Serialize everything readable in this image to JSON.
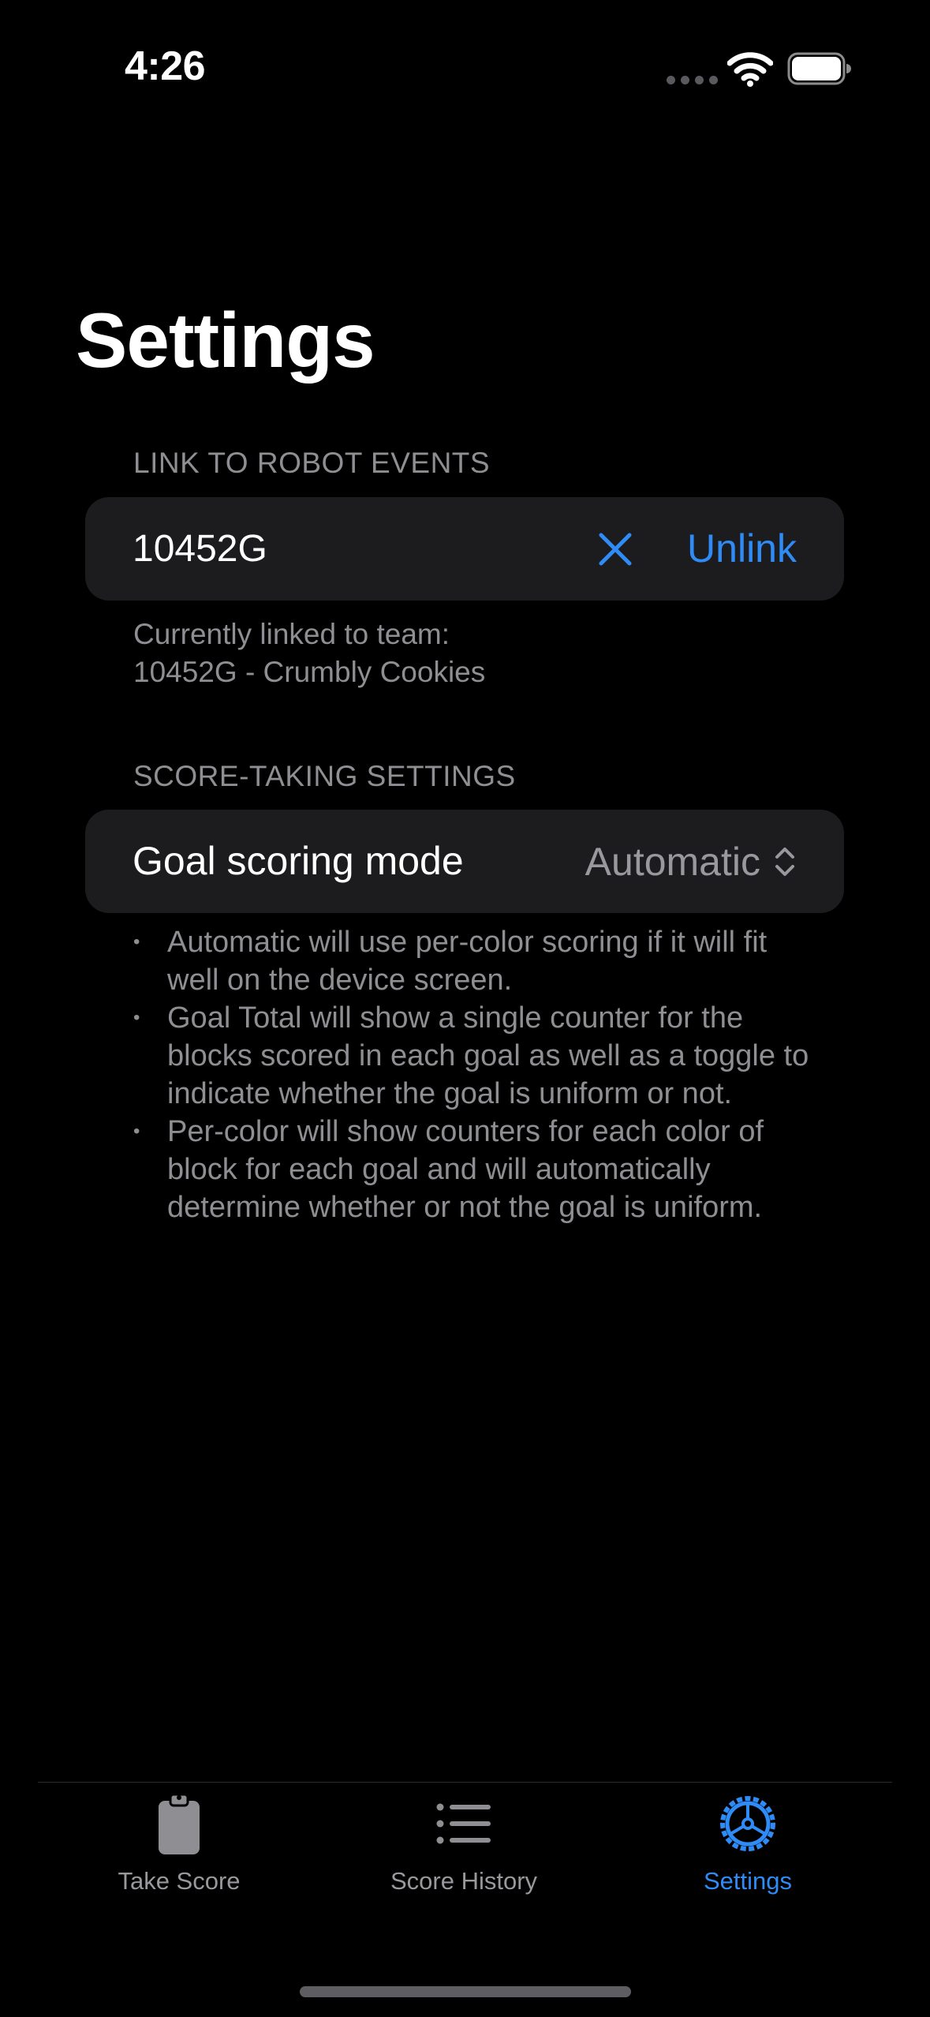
{
  "status_bar": {
    "time": "4:26"
  },
  "page": {
    "title": "Settings"
  },
  "link_section": {
    "header": "LINK TO ROBOT EVENTS",
    "team_number": "10452G",
    "unlink_label": "Unlink",
    "footer_line1": "Currently linked to team:",
    "footer_line2": "10452G - Crumbly Cookies"
  },
  "score_section": {
    "header": "SCORE-TAKING SETTINGS",
    "row_label": "Goal scoring mode",
    "selected_mode": "Automatic",
    "notes": [
      "Automatic will use per-color scoring if it will fit well on the device screen.",
      "Goal Total will show a single counter for the blocks scored in each goal as well as a toggle to indicate whether the goal is uniform or not.",
      "Per-color will show counters for each color of block for each goal and will automatically determine whether or not the goal is uniform."
    ]
  },
  "tab_bar": {
    "tabs": [
      {
        "label": "Take Score",
        "icon": "clipboard-icon"
      },
      {
        "label": "Score History",
        "icon": "list-icon"
      },
      {
        "label": "Settings",
        "icon": "gear-icon"
      }
    ],
    "active": "Settings"
  },
  "colors": {
    "accent": "#2f8cf6",
    "background": "#000000",
    "card": "#1c1c1e",
    "secondary_text": "#8e8e93"
  }
}
